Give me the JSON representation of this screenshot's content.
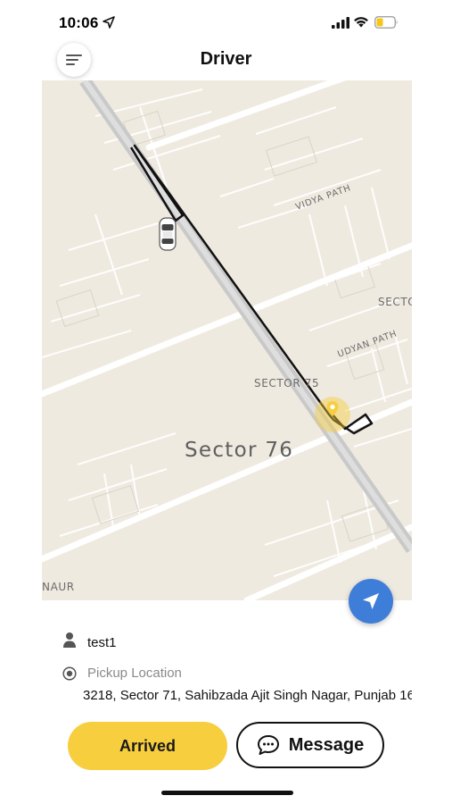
{
  "status_bar": {
    "time": "10:06",
    "location_icon": "location-arrow-icon",
    "signal_icon": "cellular-signal-icon",
    "wifi_icon": "wifi-icon",
    "battery_icon": "battery-low-icon",
    "battery_color": "#f5c518"
  },
  "header": {
    "title": "Driver",
    "menu_icon": "hamburger-menu-icon"
  },
  "map": {
    "area_label": "Sector 76",
    "sector75_label": "SECTOR 75",
    "sector_partial_label": "SECTO",
    "vidya_path_label": "VIDYA PATH",
    "udyan_path_label": "UDYAN PATH",
    "nauri_label": "NAUR",
    "car_icon": "car-icon",
    "pickup_pin_icon": "pickup-pin-icon",
    "locate_icon": "navigation-arrow-icon",
    "route_color": "#111111",
    "pin_color": "#f7ce3e",
    "map_bg_color": "#efeae0"
  },
  "rider": {
    "name": "test1",
    "icon": "person-icon"
  },
  "pickup": {
    "label": "Pickup Location",
    "address": "3218, Sector 71, Sahibzada Ajit Singh Nagar, Punjab 16",
    "icon": "radio-target-icon"
  },
  "actions": {
    "arrived_label": "Arrived",
    "message_label": "Message",
    "message_icon": "chat-bubble-icon",
    "accent_color": "#f7ce3e"
  }
}
